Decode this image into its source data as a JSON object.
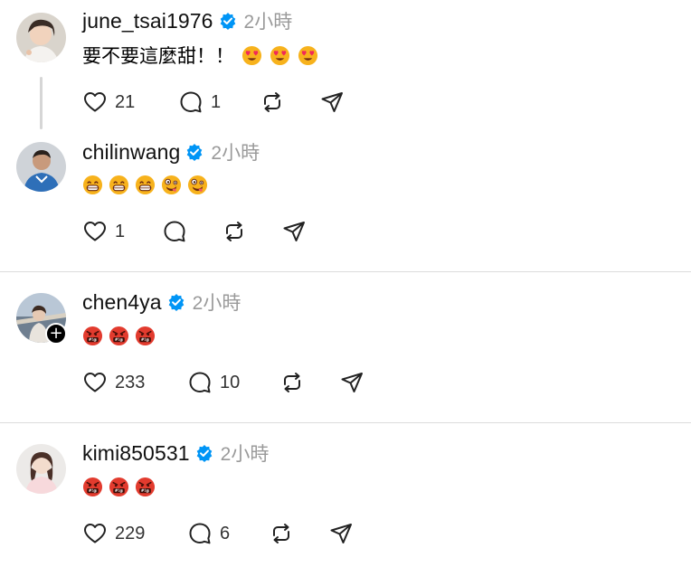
{
  "comments": [
    {
      "username": "june_tsai1976",
      "time": "2小時",
      "text": "要不要這麼甜！！",
      "emojis": [
        "heart-eyes",
        "heart-eyes",
        "heart-eyes"
      ],
      "likes": "21",
      "replies": "1",
      "follow_badge": false
    },
    {
      "username": "chilinwang",
      "time": "2小時",
      "text": "",
      "emojis": [
        "grinning",
        "grinning",
        "grinning",
        "zany",
        "zany"
      ],
      "likes": "1",
      "replies": "",
      "follow_badge": false
    },
    {
      "username": "chen4ya",
      "time": "2小時",
      "text": "",
      "emojis": [
        "cursing",
        "cursing",
        "cursing"
      ],
      "likes": "233",
      "replies": "10",
      "follow_badge": true
    },
    {
      "username": "kimi850531",
      "time": "2小時",
      "text": "",
      "emojis": [
        "cursing",
        "cursing",
        "cursing"
      ],
      "likes": "229",
      "replies": "6",
      "follow_badge": false
    }
  ],
  "icons": {
    "like": "heart-icon",
    "reply": "comment-icon",
    "repost": "repost-icon",
    "share": "send-icon",
    "verified": "verified-badge-icon",
    "follow": "plus-icon"
  },
  "colors": {
    "verified": "#0095f6",
    "muted_text": "#9a9a9a",
    "divider": "#dcdcdc"
  }
}
